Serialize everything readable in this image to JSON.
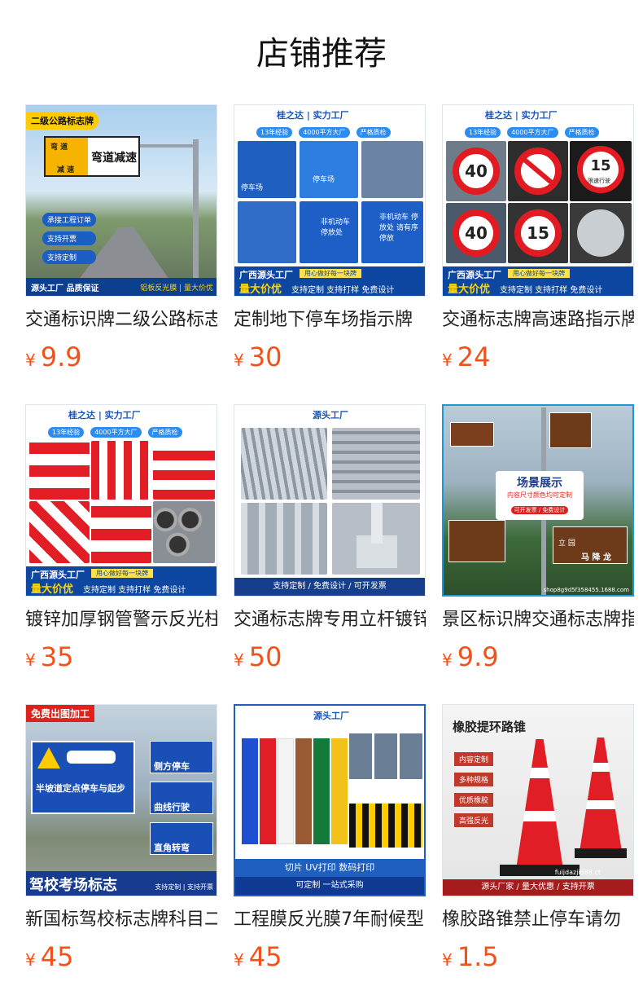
{
  "page": {
    "title": "店铺推荐"
  },
  "products": [
    {
      "name": "交通标识牌二级公路标志牌",
      "currency": "¥",
      "price": "9.9",
      "image": {
        "tag": "二级公路标志牌",
        "sign_left_top": "弯 道",
        "sign_left_bottom": "减 速",
        "sign_text": "弯道减速",
        "badges": [
          "承接工程订单",
          "支持开票",
          "支持定制"
        ],
        "footer_left": "源头工厂 品质保证",
        "footer_right": "铝板反光膜 | 量大价优"
      }
    },
    {
      "name": "定制地下停车场指示牌",
      "currency": "¥",
      "price": "30",
      "image": {
        "brand": "桂之达 | 实力工厂",
        "chips": [
          "13年经验",
          "4000平方大厂",
          "严格质检"
        ],
        "tiles": [
          "停车场",
          "停车场",
          "",
          "",
          "非机动车 停放处",
          "非机动车 停放处 请有序停放"
        ],
        "footer_top": "广西源头工厂",
        "footer_bottom": "量大价优",
        "footer_slogan": "用心做好每一块牌",
        "footer_services": "支持定制 支持打样 免费设计"
      }
    },
    {
      "name": "交通标志牌高速路指示牌",
      "currency": "¥",
      "price": "24",
      "image": {
        "brand": "桂之达 | 实力工厂",
        "chips": [
          "13年经验",
          "4000平方大厂",
          "严格质检"
        ],
        "signs": [
          "40",
          "",
          "15",
          "40",
          "15",
          ""
        ],
        "sign_sub": "限速行驶",
        "footer_top": "广西源头工厂",
        "footer_bottom": "量大价优",
        "footer_slogan": "用心做好每一块牌",
        "footer_services": "支持定制 支持打样 免费设计"
      }
    },
    {
      "name": "镀锌加厚钢管警示反光柱",
      "currency": "¥",
      "price": "35",
      "image": {
        "brand": "桂之达 | 实力工厂",
        "chips": [
          "13年经验",
          "4000平方大厂",
          "严格质检"
        ],
        "footer_top": "广西源头工厂",
        "footer_bottom": "量大价优",
        "footer_slogan": "用心做好每一块牌",
        "footer_services": "支持定制 支持打样 免费设计"
      }
    },
    {
      "name": "交通标志牌专用立杆镀锌",
      "currency": "¥",
      "price": "50",
      "image": {
        "brand": "源头工厂",
        "caption": "支持定制 / 免费设计 / 可开发票"
      }
    },
    {
      "name": "景区标识牌交通标志牌指示",
      "currency": "¥",
      "price": "9.9",
      "image": {
        "banner_title": "场景展示",
        "banner_sub": "内容尺寸颜色均可定制",
        "banner_tag": "可开发票 / 免费设计",
        "sign_a": "立 园",
        "sign_b": "马 降 龙",
        "watermark": "shop8g9d5f358455.1688.com"
      }
    },
    {
      "name": "新国标驾校标志牌科目二",
      "currency": "¥",
      "price": "45",
      "image": {
        "tag": "免费出图加工",
        "main_sign": "半坡道定点停车与起步",
        "side_signs": [
          "侧方停车",
          "曲线行驶",
          "直角转弯"
        ],
        "footer_big": "驾校考场标志",
        "footer_note": "支持定制 | 支持开票"
      }
    },
    {
      "name": "工程膜反光膜7年耐候型",
      "currency": "¥",
      "price": "45",
      "image": {
        "brand": "源头工厂",
        "services": "切片  UV打印  数码打印",
        "caption": "可定制 一站式采购"
      }
    },
    {
      "name": "橡胶路锥禁止停车请勿",
      "currency": "¥",
      "price": "1.5",
      "image": {
        "title": "橡胶提环路锥",
        "features": [
          "内容定制",
          "多种规格",
          "优质橡胶",
          "高强反光"
        ],
        "caption": "源头厂家 / 量大优惠 / 支持开票",
        "watermark": "fuijdazji688.ct"
      }
    }
  ]
}
